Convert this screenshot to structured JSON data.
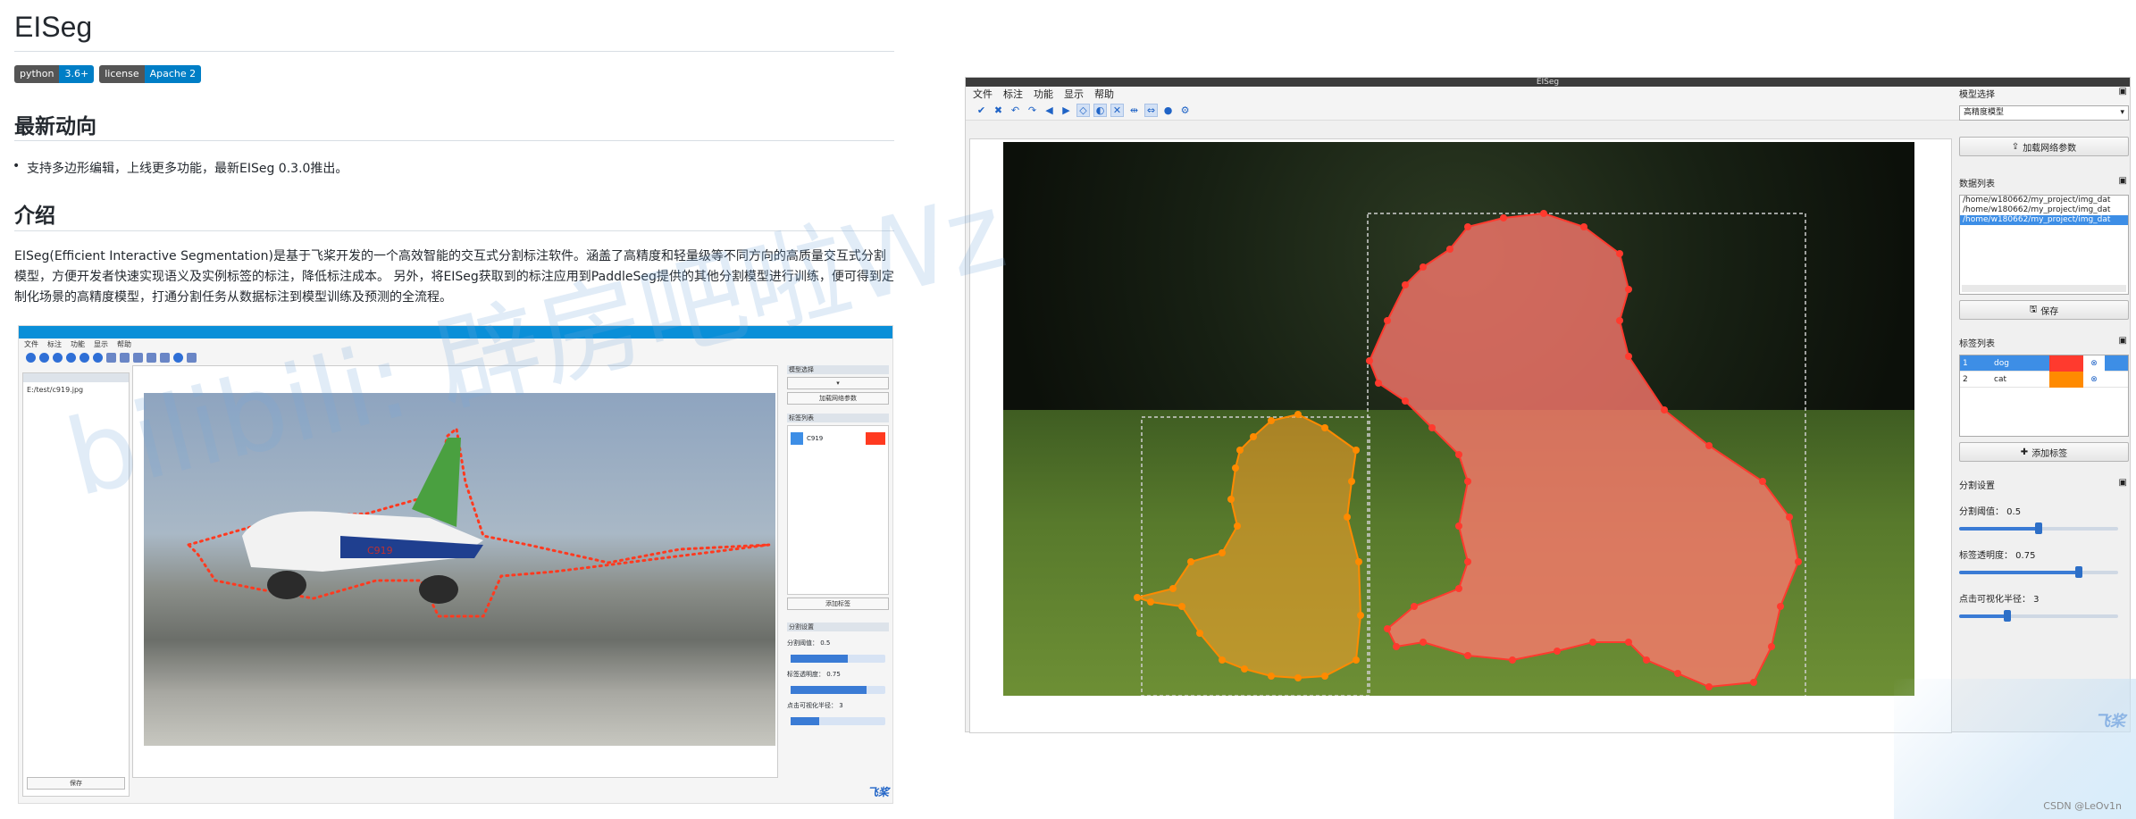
{
  "doc": {
    "title": "EISeg",
    "badges": [
      {
        "key": "python",
        "value": "3.6+"
      },
      {
        "key": "license",
        "value": "Apache 2"
      }
    ],
    "news_heading": "最新动向",
    "news_item": "支持多边形编辑，上线更多功能，最新EISeg 0.3.0推出。",
    "intro_heading": "介绍",
    "intro_text": "EISeg(Efficient Interactive Segmentation)是基于飞桨开发的一个高效智能的交互式分割标注软件。涵盖了高精度和轻量级等不同方向的高质量交互式分割模型，方便开发者快速实现语义及实例标签的标注，降低标注成本。 另外，将EISeg获取到的标注应用到PaddleSeg提供的其他分割模型进行训练，便可得到定制化场景的高精度模型，打通分割任务从数据标注到模型训练及预测的全流程。"
  },
  "mini_app": {
    "menus": [
      "文件",
      "标注",
      "功能",
      "显示",
      "帮助"
    ],
    "file_item": "E:/test/c919.jpg",
    "save_label": "保存",
    "label_name": "C919",
    "plane_text": "C919",
    "add_label": "添加标签",
    "panel_titles": [
      "模型选择",
      "标签列表",
      "分割设置"
    ],
    "model_button": "加载网络参数",
    "slider_labels": [
      "分割阈值： 0.5",
      "标签透明度： 0.75",
      "点击可视化半径： 3"
    ],
    "logo": "飞桨"
  },
  "app": {
    "window_title": "EISeg",
    "menus": [
      "文件",
      "标注",
      "功能",
      "显示",
      "帮助"
    ],
    "panels": {
      "model": {
        "title": "模型选择",
        "selected": "高精度模型",
        "load_button": "加载网络参数"
      },
      "data": {
        "title": "数据列表",
        "items": [
          "/home/w180662/my_project/img_dat",
          "/home/w180662/my_project/img_dat",
          "/home/w180662/my_project/img_dat"
        ],
        "save_button": "保存"
      },
      "labels": {
        "title": "标签列表",
        "rows": [
          {
            "id": "1",
            "name": "dog",
            "color": "#ff3a2e"
          },
          {
            "id": "2",
            "name": "cat",
            "color": "#ff8a00"
          }
        ],
        "add_button": "添加标签"
      },
      "settings": {
        "title": "分割设置",
        "threshold_label": "分割阈值： 0.5",
        "threshold_value": 0.5,
        "opacity_label": "标签透明度： 0.75",
        "opacity_value": 0.75,
        "radius_label": "点击可视化半径： 3",
        "radius_value": 0.3
      }
    },
    "logo": "飞桨"
  },
  "watermark": "bilibili: 辟房吧啦Wz",
  "credit": "CSDN @LeOv1n",
  "colors": {
    "dog": "#ff3a2e",
    "cat": "#ff8a00",
    "accent": "#3d8ee6"
  }
}
